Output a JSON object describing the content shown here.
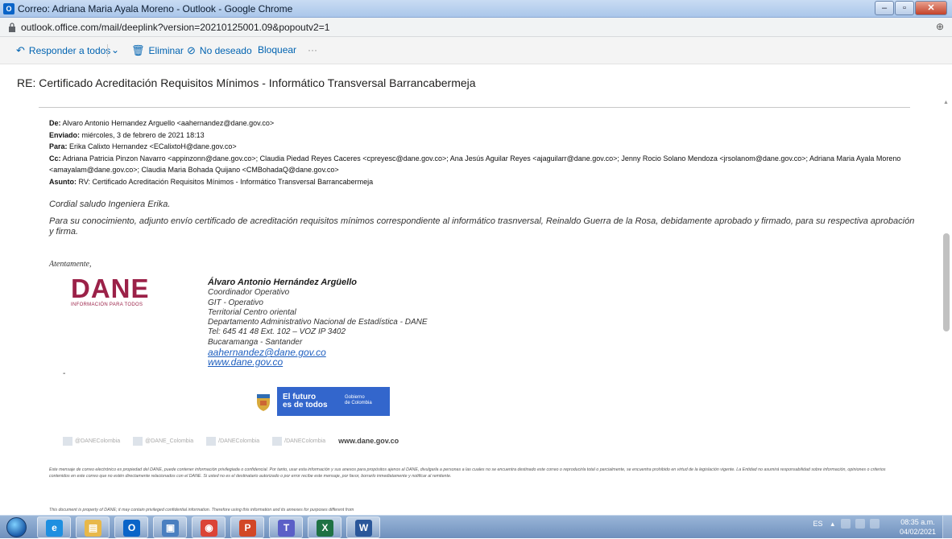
{
  "window": {
    "title": "Correo: Adriana Maria Ayala Moreno - Outlook - Google Chrome",
    "app_icon_label": "O"
  },
  "address": {
    "url": "outlook.office.com/mail/deeplink?version=20210125001.09&popoutv2=1"
  },
  "toolbar": {
    "reply_all": "Responder a todos",
    "delete": "Eliminar",
    "junk": "No deseado",
    "block": "Bloquear",
    "more": "···"
  },
  "subject": "RE: Certificado Acreditación Requisitos Mínimos - Informático Transversal Barrancabermeja",
  "headers": {
    "from_label": "De:",
    "from": "Alvaro Antonio Hernandez Arguello <aahernandez@dane.gov.co>",
    "sent_label": "Enviado:",
    "sent": "miércoles, 3 de febrero de 2021 18:13",
    "to_label": "Para:",
    "to": "Erika Calixto Hernandez <ECalixtoH@dane.gov.co>",
    "cc_label": "Cc:",
    "cc": "Adriana Patricia Pinzon Navarro <appinzonn@dane.gov.co>; Claudia Piedad Reyes Caceres <cpreyesc@dane.gov.co>; Ana Jesús Aguilar Reyes <ajaguilarr@dane.gov.co>; Jenny Rocio Solano Mendoza <jrsolanom@dane.gov.co>; Adriana Maria Ayala Moreno <amayalam@dane.gov.co>; Claudia Maria Bohada Quijano <CMBohadaQ@dane.gov.co>",
    "subject_label": "Asunto:",
    "subject": "RV: Certificado Acreditación Requisitos Mínimos - Informático Transversal Barrancabermeja"
  },
  "body": {
    "greeting": "Cordial saludo Ingeniera Erika.",
    "paragraph": "Para su conocimiento, adjunto envío certificado de acreditación requisitos mínimos correspondiente al informático trasnversal, Reinaldo Guerra de la Rosa, debidamente aprobado y firmado, para su respectiva aprobación y firma.",
    "closing": "Atentamente,"
  },
  "signature": {
    "logo_word": "DANE",
    "logo_tagline": "INFORMACIÓN PARA TODOS",
    "name": "Álvaro Antonio Hernández Argüello",
    "role": "Coordinador Operativo",
    "group": "GIT - Operativo",
    "territory": "Territorial Centro oriental",
    "org": "Departamento Administrativo Nacional de Estadística - DANE",
    "phone": "Tel: 645 41 48 Ext. 102 – VOZ IP 3402",
    "city": "Bucaramanga - Santander",
    "email": "aahernandez@dane.gov.co",
    "web": "www.dane.gov.co",
    "dash": "-"
  },
  "gov_banner": {
    "line1": "El futuro",
    "line2": "es de todos",
    "gob1": "Gobierno",
    "gob2": "de Colombia"
  },
  "social": {
    "handles": [
      "@DANEColombia",
      "@DANE_Colombia",
      "/DANEColombia",
      "/DANEColombia"
    ],
    "site": "www.dane.gov.co"
  },
  "disclaimer": {
    "es": "Este mensaje de correo electrónico es propiedad del DANE, puede contener información privilegiada o confidencial. Por tanto, usar esta información y sus anexos para propósitos ajenos al DANE, divulgarla a personas a las cuales no se encuentra destinado este correo o reproducirla total o parcialmente, se encuentra prohibido en virtud de la legislación vigente. La Entidad no asumirá responsabilidad sobre información, opiniones o criterios contenidos en este correo que no estén directamente relacionados con el DANE. Si usted no es el destinatario autorizado o por error recibe este mensaje, por favor, borrarlo inmediatamente y notificar al remitente.",
    "en": "This document is property of DANE; it may contain privileged confidential information. Therefore using this information and its annexes for purposes different from"
  },
  "taskbar": {
    "apps": [
      {
        "name": "internet-explorer",
        "glyph": "e",
        "color": "#1e8fe0"
      },
      {
        "name": "file-explorer",
        "glyph": "▤",
        "color": "#e8b84a"
      },
      {
        "name": "outlook",
        "glyph": "O",
        "color": "#0a64c8"
      },
      {
        "name": "calendar",
        "glyph": "▣",
        "color": "#4a7fc0"
      },
      {
        "name": "chrome",
        "glyph": "◉",
        "color": "#db4437"
      },
      {
        "name": "powerpoint",
        "glyph": "P",
        "color": "#d24726"
      },
      {
        "name": "teams",
        "glyph": "T",
        "color": "#5b5fc7"
      },
      {
        "name": "excel",
        "glyph": "X",
        "color": "#1f7244"
      },
      {
        "name": "word",
        "glyph": "W",
        "color": "#2b579a"
      }
    ],
    "lang": "ES",
    "time": "08:35 a.m.",
    "date": "04/02/2021"
  }
}
